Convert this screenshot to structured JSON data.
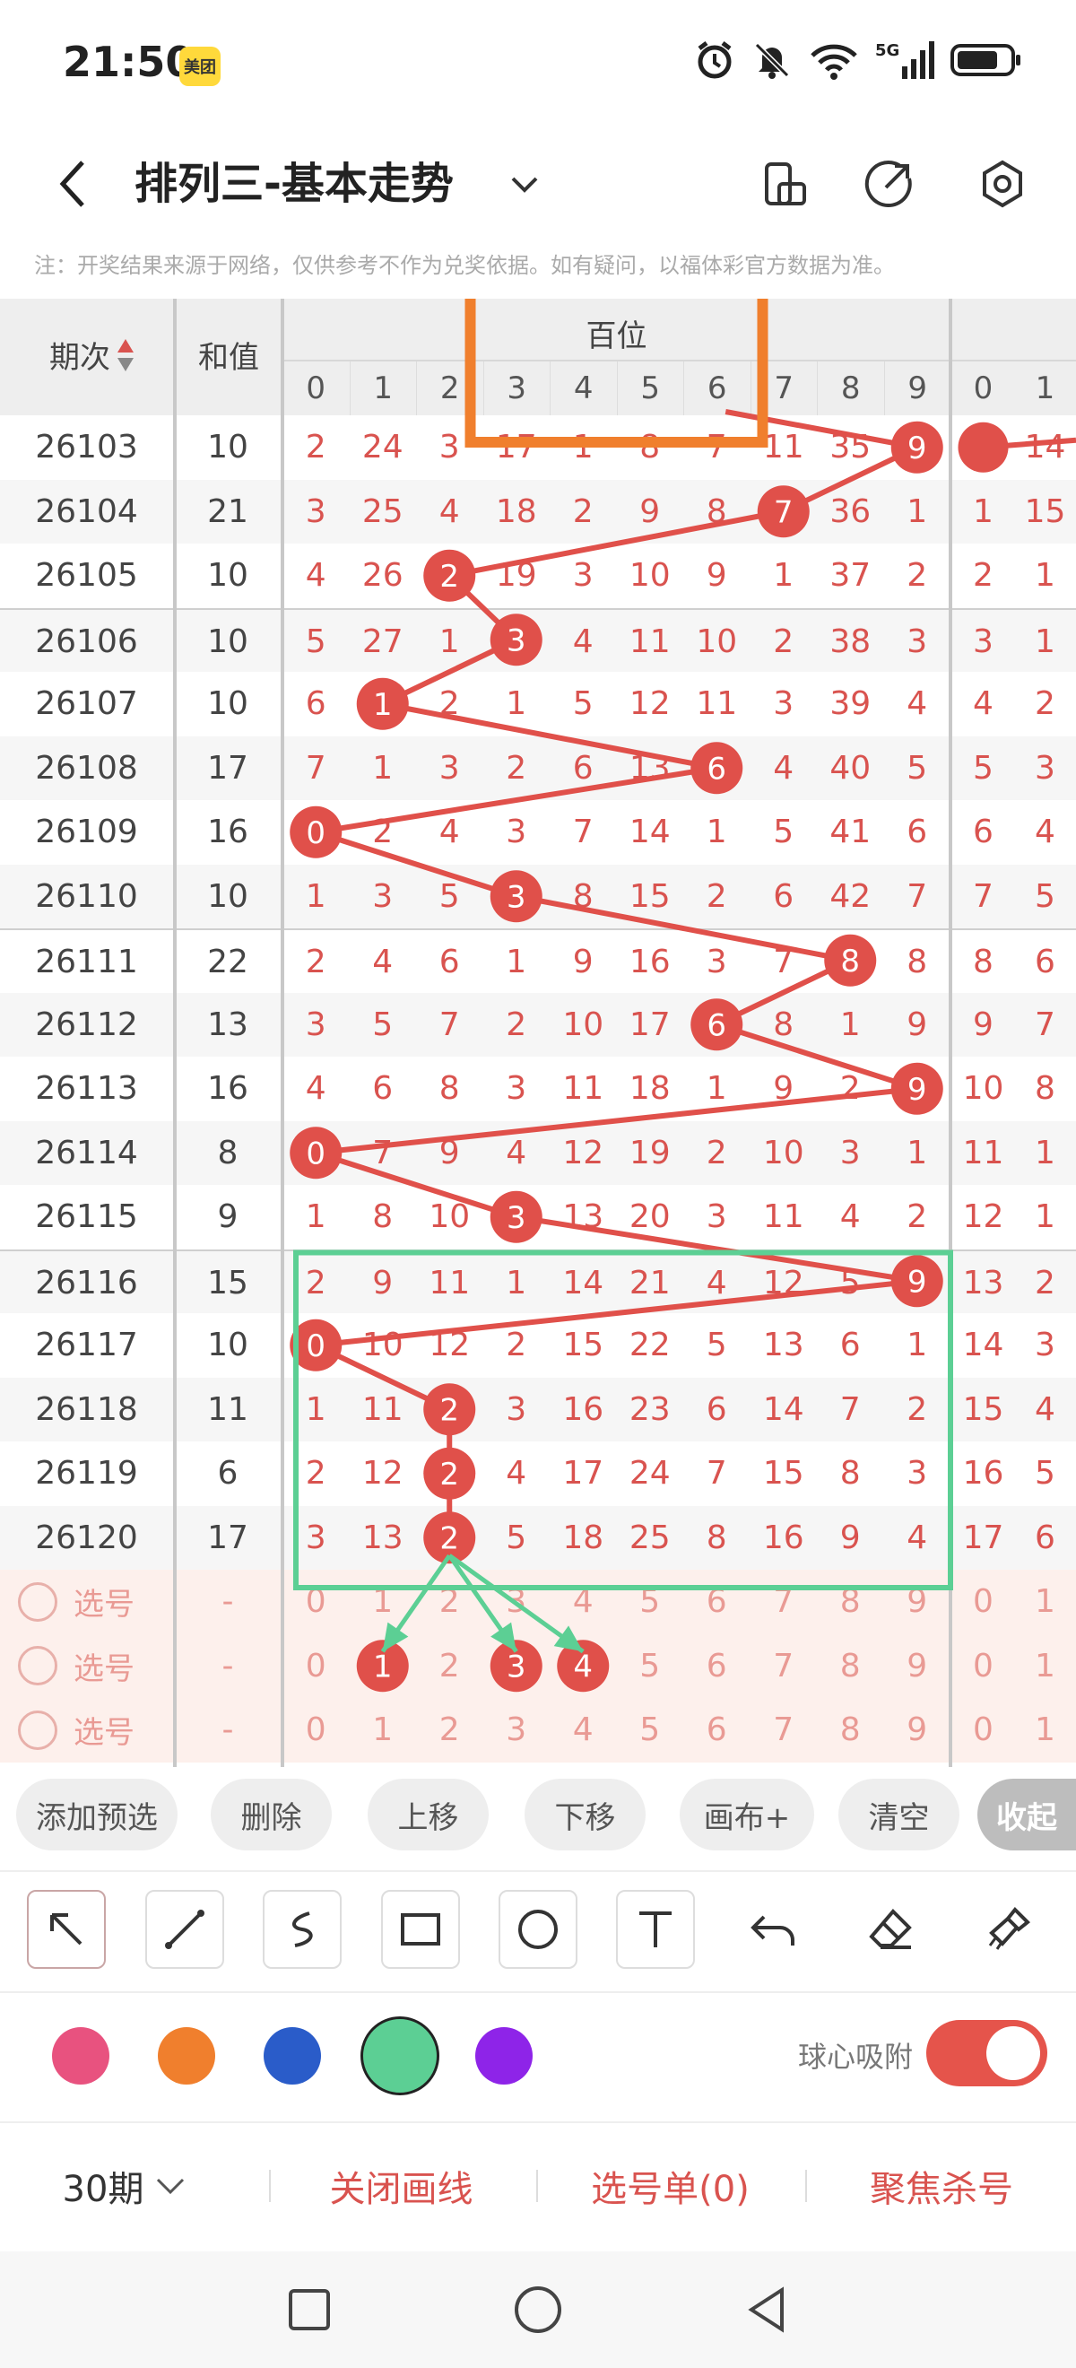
{
  "status": {
    "time": "21:50",
    "badge": "美团"
  },
  "header": {
    "title": "排列三-基本走势"
  },
  "note": "注：开奖结果来源于网络，仅供参考不作为兑奖依据。如有疑问，以福体彩官方数据为准。",
  "table": {
    "head_issue": "期次",
    "head_sum": "和值",
    "group_label": "百位",
    "digits": [
      "0",
      "1",
      "2",
      "3",
      "4",
      "5",
      "6",
      "7",
      "8",
      "9"
    ],
    "next_digits": [
      "0",
      "1"
    ],
    "rows": [
      {
        "issue": "26103",
        "sum": "10",
        "cells": [
          "2",
          "24",
          "3",
          "17",
          "1",
          "8",
          "7",
          "11",
          "35",
          "9"
        ],
        "hit": 9,
        "next": [
          "0",
          "14"
        ]
      },
      {
        "issue": "26104",
        "sum": "21",
        "cells": [
          "3",
          "25",
          "4",
          "18",
          "2",
          "9",
          "8",
          "7",
          "36",
          "1"
        ],
        "hit": 7,
        "next": [
          "1",
          "15"
        ]
      },
      {
        "issue": "26105",
        "sum": "10",
        "cells": [
          "4",
          "26",
          "2",
          "19",
          "3",
          "10",
          "9",
          "1",
          "37",
          "2"
        ],
        "hit": 2,
        "next": [
          "2",
          "1"
        ]
      },
      {
        "issue": "26106",
        "sum": "10",
        "cells": [
          "5",
          "27",
          "1",
          "3",
          "4",
          "11",
          "10",
          "2",
          "38",
          "3"
        ],
        "hit": 3,
        "next": [
          "3",
          "1"
        ]
      },
      {
        "issue": "26107",
        "sum": "10",
        "cells": [
          "6",
          "1",
          "2",
          "1",
          "5",
          "12",
          "11",
          "3",
          "39",
          "4"
        ],
        "hit": 1,
        "next": [
          "4",
          "2"
        ]
      },
      {
        "issue": "26108",
        "sum": "17",
        "cells": [
          "7",
          "1",
          "3",
          "2",
          "6",
          "13",
          "6",
          "4",
          "40",
          "5"
        ],
        "hit": 6,
        "next": [
          "5",
          "3"
        ]
      },
      {
        "issue": "26109",
        "sum": "16",
        "cells": [
          "0",
          "2",
          "4",
          "3",
          "7",
          "14",
          "1",
          "5",
          "41",
          "6"
        ],
        "hit": 0,
        "next": [
          "6",
          "4"
        ]
      },
      {
        "issue": "26110",
        "sum": "10",
        "cells": [
          "1",
          "3",
          "5",
          "3",
          "8",
          "15",
          "2",
          "6",
          "42",
          "7"
        ],
        "hit": 3,
        "next": [
          "7",
          "5"
        ]
      },
      {
        "issue": "26111",
        "sum": "22",
        "cells": [
          "2",
          "4",
          "6",
          "1",
          "9",
          "16",
          "3",
          "7",
          "8",
          "8"
        ],
        "hit": 8,
        "next": [
          "8",
          "6"
        ]
      },
      {
        "issue": "26112",
        "sum": "13",
        "cells": [
          "3",
          "5",
          "7",
          "2",
          "10",
          "17",
          "6",
          "8",
          "1",
          "9"
        ],
        "hit": 6,
        "next": [
          "9",
          "7"
        ]
      },
      {
        "issue": "26113",
        "sum": "16",
        "cells": [
          "4",
          "6",
          "8",
          "3",
          "11",
          "18",
          "1",
          "9",
          "2",
          "9"
        ],
        "hit": 9,
        "next": [
          "10",
          "8"
        ]
      },
      {
        "issue": "26114",
        "sum": "8",
        "cells": [
          "0",
          "7",
          "9",
          "4",
          "12",
          "19",
          "2",
          "10",
          "3",
          "1"
        ],
        "hit": 0,
        "next": [
          "11",
          "1"
        ]
      },
      {
        "issue": "26115",
        "sum": "9",
        "cells": [
          "1",
          "8",
          "10",
          "3",
          "13",
          "20",
          "3",
          "11",
          "4",
          "2"
        ],
        "hit": 3,
        "next": [
          "12",
          "1"
        ]
      },
      {
        "issue": "26116",
        "sum": "15",
        "cells": [
          "2",
          "9",
          "11",
          "1",
          "14",
          "21",
          "4",
          "12",
          "5",
          "9"
        ],
        "hit": 9,
        "next": [
          "13",
          "2"
        ]
      },
      {
        "issue": "26117",
        "sum": "10",
        "cells": [
          "0",
          "10",
          "12",
          "2",
          "15",
          "22",
          "5",
          "13",
          "6",
          "1"
        ],
        "hit": 0,
        "next": [
          "14",
          "3"
        ]
      },
      {
        "issue": "26118",
        "sum": "11",
        "cells": [
          "1",
          "11",
          "2",
          "3",
          "16",
          "23",
          "6",
          "14",
          "7",
          "2"
        ],
        "hit": 2,
        "next": [
          "15",
          "4"
        ]
      },
      {
        "issue": "26119",
        "sum": "6",
        "cells": [
          "2",
          "12",
          "2",
          "4",
          "17",
          "24",
          "7",
          "15",
          "8",
          "3"
        ],
        "hit": 2,
        "next": [
          "16",
          "5"
        ]
      },
      {
        "issue": "26120",
        "sum": "17",
        "cells": [
          "3",
          "13",
          "2",
          "5",
          "18",
          "25",
          "8",
          "16",
          "9",
          "4"
        ],
        "hit": 2,
        "next": [
          "17",
          "6"
        ]
      }
    ],
    "pick_rows": [
      {
        "label": "选号",
        "sum": "-",
        "cells": [
          "0",
          "1",
          "2",
          "3",
          "4",
          "5",
          "6",
          "7",
          "8",
          "9"
        ],
        "picked": [],
        "next": [
          "0",
          "1"
        ]
      },
      {
        "label": "选号",
        "sum": "-",
        "cells": [
          "0",
          "1",
          "2",
          "3",
          "4",
          "5",
          "6",
          "7",
          "8",
          "9"
        ],
        "picked": [
          1,
          3,
          4
        ],
        "next": [
          "0",
          "1"
        ]
      },
      {
        "label": "选号",
        "sum": "-",
        "cells": [
          "0",
          "1",
          "2",
          "3",
          "4",
          "5",
          "6",
          "7",
          "8",
          "9"
        ],
        "picked": [],
        "next": [
          "0",
          "1"
        ]
      }
    ]
  },
  "actions": {
    "add_preselect": "添加预选",
    "delete": "删除",
    "move_up": "上移",
    "move_down": "下移",
    "canvas_plus": "画布+",
    "clear": "清空",
    "collapse": "收起"
  },
  "colors": {
    "pink": "#e8527f",
    "orange": "#f07f2d",
    "blue": "#2a5cc9",
    "green": "#5ccf94",
    "purple": "#8e24e8",
    "accent": "#e5544b"
  },
  "snap_label": "球心吸附",
  "bottom": {
    "periods": "30期",
    "close_lines": "关闭画线",
    "pick_list": "选号单(0)",
    "focus_kill": "聚焦杀号"
  }
}
